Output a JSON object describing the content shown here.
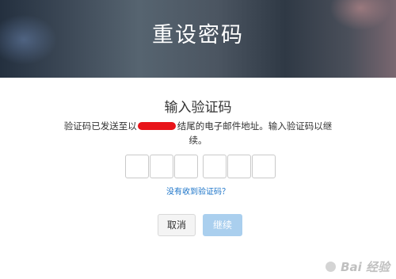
{
  "banner": {
    "title": "重设密码"
  },
  "dialog": {
    "heading": "输入验证码",
    "desc_before": "验证码已发送至以",
    "desc_after": "结尾的电子邮件地址。输入验证码以继续。",
    "resend_link": "没有收到验证码？",
    "code_boxes": 6
  },
  "buttons": {
    "cancel": "取消",
    "continue": "继续"
  },
  "watermark": {
    "text": "Bai  经验"
  },
  "colors": {
    "link": "#1a73c8",
    "continue_disabled": "#aacfee",
    "redaction": "#e8141a"
  }
}
